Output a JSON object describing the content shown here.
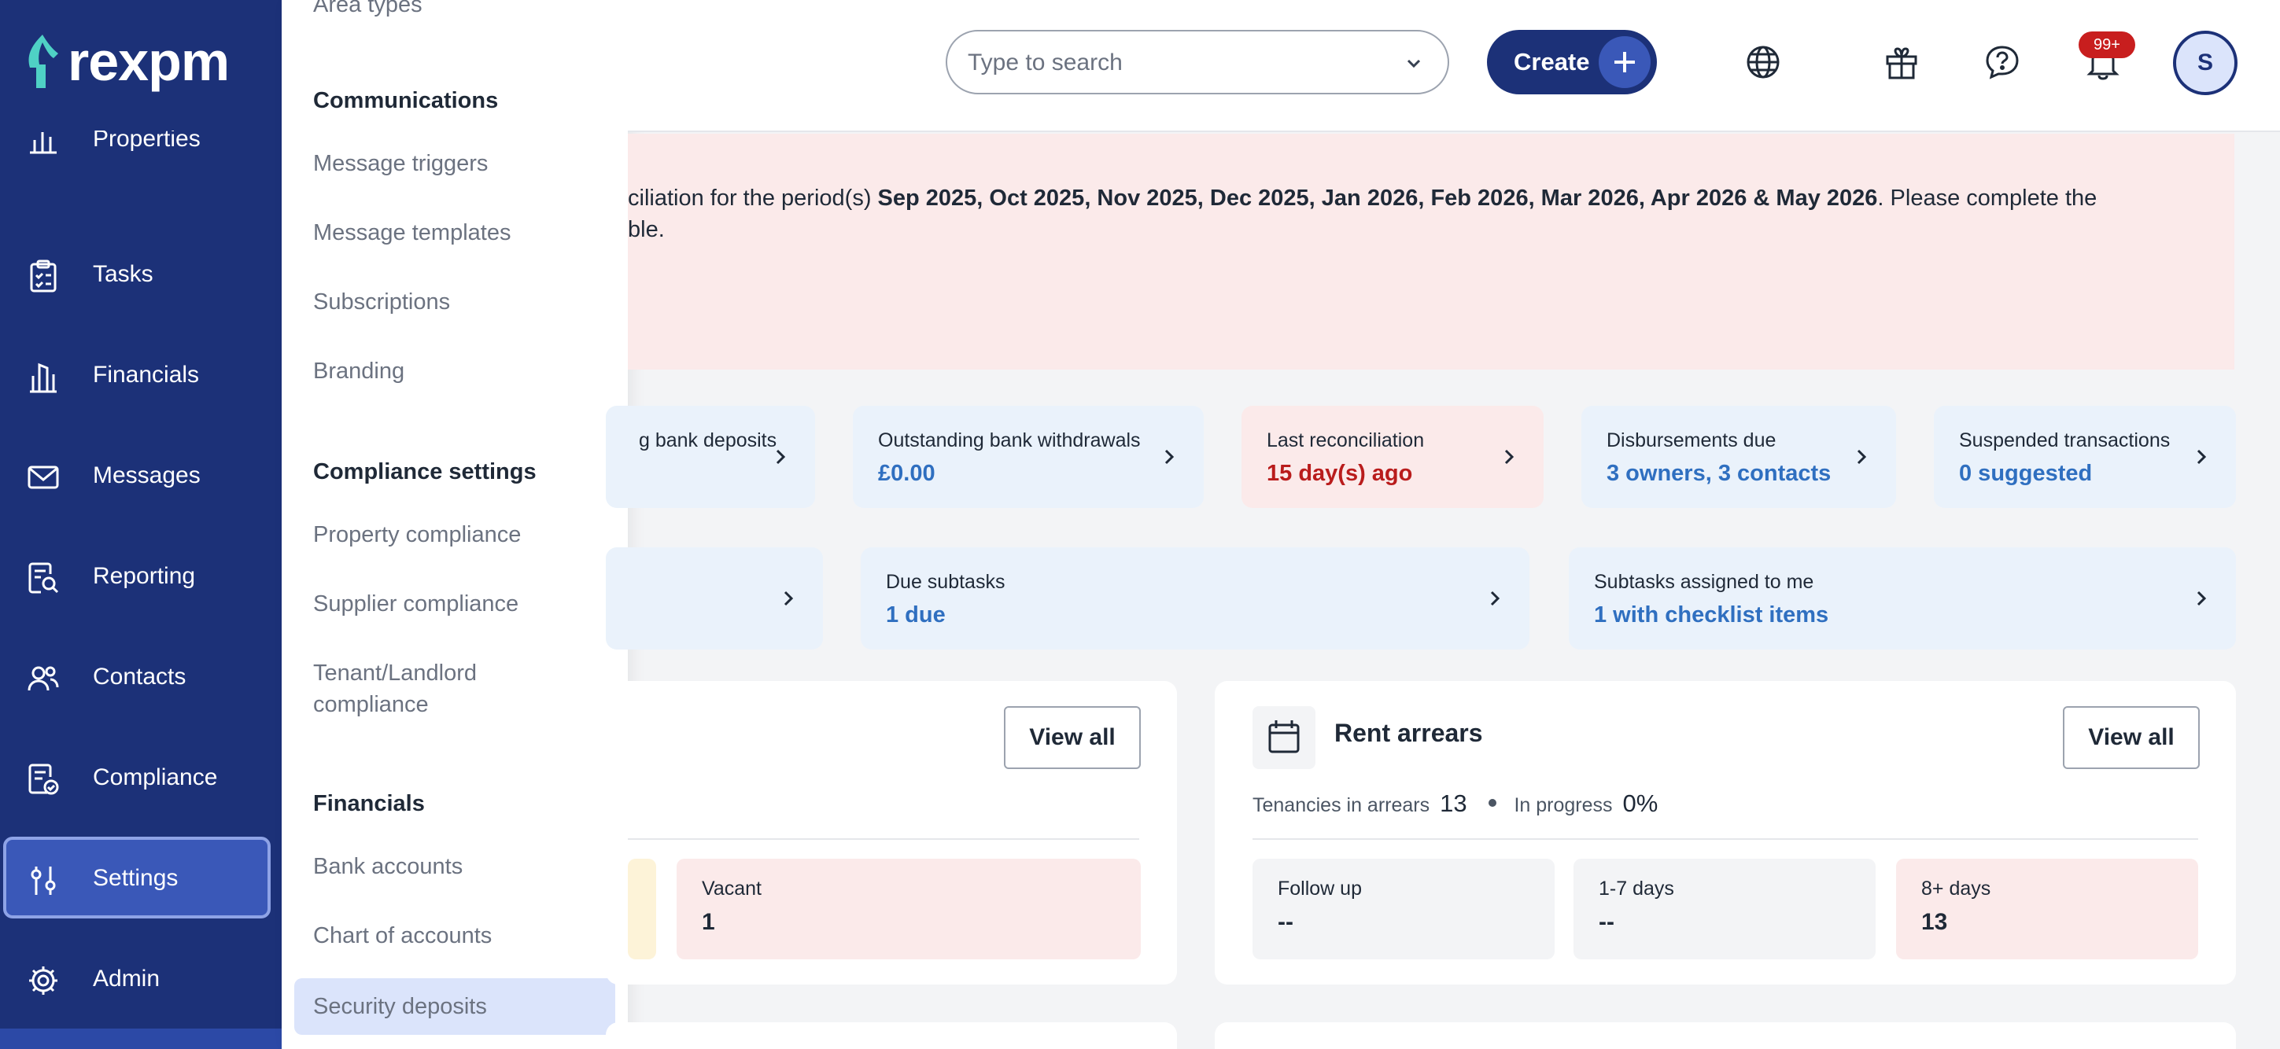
{
  "app": {
    "logo_text": "rexpm"
  },
  "colors": {
    "sidebar": "#1c3178",
    "accent": "#2f6fc0",
    "alert_bg": "#fbeaea",
    "danger": "#b91c1c"
  },
  "sidebar": {
    "items": [
      {
        "label": "Properties",
        "icon": "home-chart-icon"
      },
      {
        "label": "Tasks",
        "icon": "clipboard-icon"
      },
      {
        "label": "Financials",
        "icon": "bank-icon"
      },
      {
        "label": "Messages",
        "icon": "mail-icon"
      },
      {
        "label": "Reporting",
        "icon": "report-search-icon"
      },
      {
        "label": "Contacts",
        "icon": "users-icon"
      },
      {
        "label": "Compliance",
        "icon": "compliance-icon"
      },
      {
        "label": "Settings",
        "icon": "sliders-icon"
      },
      {
        "label": "Admin",
        "icon": "gear-icon"
      }
    ]
  },
  "flyout": {
    "top_item": "Area types",
    "communications": {
      "heading": "Communications",
      "items": [
        "Message triggers",
        "Message templates",
        "Subscriptions",
        "Branding"
      ]
    },
    "compliance": {
      "heading": "Compliance settings",
      "items": [
        "Property compliance",
        "Supplier compliance",
        "Tenant/Landlord",
        "compliance"
      ]
    },
    "financials": {
      "heading": "Financials",
      "items": [
        "Bank accounts",
        "Chart of accounts",
        "Security deposits"
      ]
    }
  },
  "topbar": {
    "search_placeholder": "Type to search",
    "create_label": "Create",
    "notifications_badge": "99+",
    "avatar_initial": "S"
  },
  "alert": {
    "prefix": "ciliation for the period(s) ",
    "periods": "Sep 2025, Oct 2025, Nov 2025, Dec 2025, Jan 2026, Feb 2026, Mar 2026, Apr 2026 & May 2026",
    "suffix": ". Please complete the",
    "line2": "ble."
  },
  "stats_row1": [
    {
      "title": "g bank deposits",
      "value": ""
    },
    {
      "title": "Outstanding bank withdrawals",
      "value": "£0.00"
    },
    {
      "title": "Last reconciliation",
      "value": "15 day(s) ago"
    },
    {
      "title": "Disbursements due",
      "value": "3 owners, 3 contacts"
    },
    {
      "title": "Suspended transactions",
      "value": "0 suggested"
    }
  ],
  "stats_row2": [
    {
      "title": "Due subtasks",
      "value": "1 due"
    },
    {
      "title": "Subtasks assigned to me",
      "value": "1 with checklist items"
    }
  ],
  "left_panel": {
    "view_all": "View all",
    "vacant_label": "Vacant",
    "vacant_value": "1"
  },
  "rent_arrears": {
    "title": "Rent arrears",
    "view_all": "View all",
    "tenancies_label": "Tenancies in arrears",
    "tenancies_value": "13",
    "progress_label": "In progress",
    "progress_value": "0%",
    "buckets": [
      {
        "label": "Follow up",
        "value": "--"
      },
      {
        "label": "1-7 days",
        "value": "--"
      },
      {
        "label": "8+ days",
        "value": "13"
      }
    ]
  }
}
